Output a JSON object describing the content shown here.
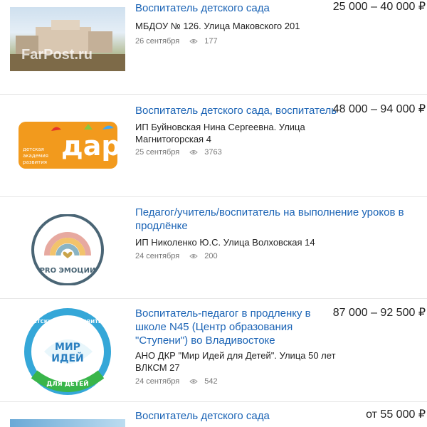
{
  "listings": [
    {
      "title": "Воспитатель детского сада",
      "price": "25 000 – 40 000 ₽",
      "company": "МБДОУ № 126. Улица Маковского 201",
      "date": "26 сентября",
      "views": "177",
      "thumb_watermark": "FarPost.ru"
    },
    {
      "title": "Воспитатель детского сада, воспитатель",
      "price": "48 000 – 94 000 ₽",
      "company_line1": "ИП Буйновская Нина Сергеевна. Улица",
      "company_line2": "Магнитогорская 4",
      "date": "25 сентября",
      "views": "3763",
      "logo_text": "дар",
      "logo_sub1": "детская",
      "logo_sub2": "академия",
      "logo_sub3": "развития"
    },
    {
      "title_line1": "Педагог/учитель/воспитатель на выполнение уроков в",
      "title_line2": "продлёнке",
      "company": "ИП Николенко Ю.С. Улица Волховская 14",
      "date": "24 сентября",
      "views": "200",
      "logo_text": "PRO ЭМОЦИИ"
    },
    {
      "title_line1": "Воспитатель-педагог в продленку в",
      "title_line2": "школе N45 (Центр образования",
      "title_line3": "\"Ступени\") во Владивостоке",
      "price": "87 000 – 92 500 ₽",
      "company_line1": "АНО ДКР \"Мир Идей для Детей\". Улица 50 лет",
      "company_line2": "ВЛКСМ 27",
      "date": "24 сентября",
      "views": "542",
      "logo_top": "ДЕТСКИЙ КЛУБ РАЗВИТИЯ",
      "logo_mid1": "МИР",
      "logo_mid2": "ИДЕЙ",
      "logo_bottom": "ДЛЯ ДЕТЕЙ"
    },
    {
      "title": "Воспитатель детского сада",
      "price": "от 55 000 ₽"
    }
  ],
  "colors": {
    "link": "#1a63b5",
    "meta": "#777777",
    "divider": "#e6e6e6"
  },
  "icons": {
    "views": "eye-icon"
  }
}
